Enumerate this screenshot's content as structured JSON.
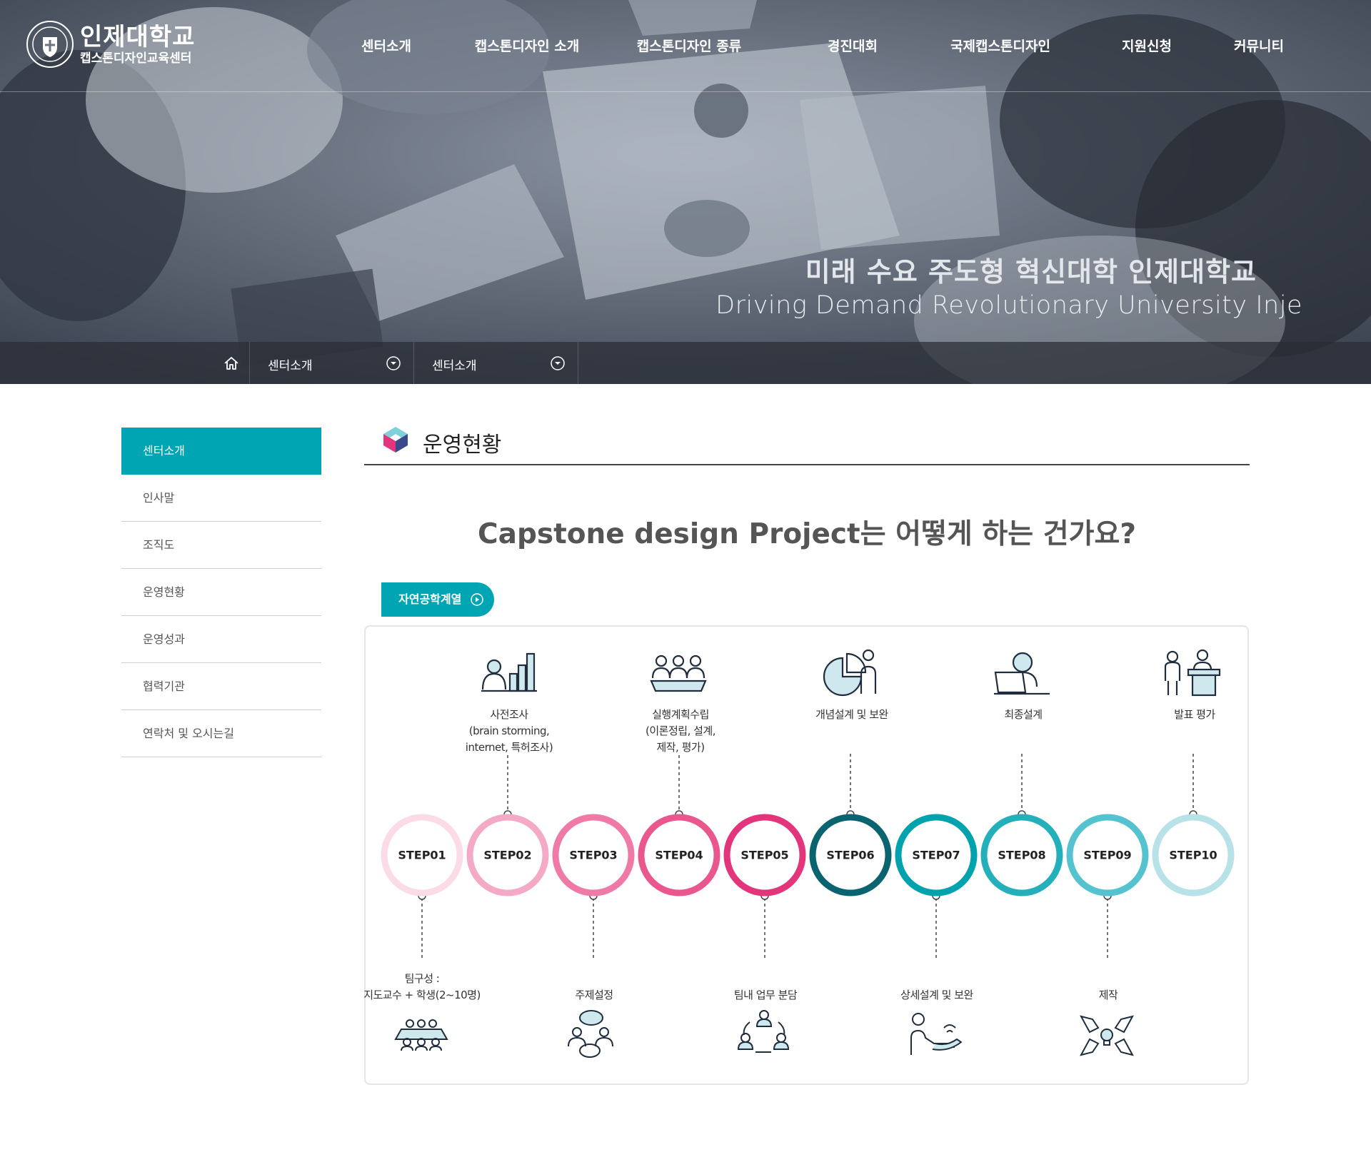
{
  "header": {
    "logo_name": "인제대학교",
    "logo_sub": "캡스톤디자인교육센터",
    "nav": [
      "센터소개",
      "캡스톤디자인 소개",
      "캡스톤디자인 종류",
      "경진대회",
      "국제캡스톤디자인",
      "지원신청",
      "커뮤니티"
    ]
  },
  "hero": {
    "title": "미래 수요 주도형 혁신대학 인제대학교",
    "subtitle": "Driving Demand Revolutionary University Inje"
  },
  "breadcrumb": {
    "home_icon": "home-icon",
    "level1": "센터소개",
    "level2": "센터소개"
  },
  "lnb": {
    "items": [
      "센터소개",
      "인사말",
      "조직도",
      "운영현황",
      "운영성과",
      "협력기관",
      "연락처 및 오시는길"
    ],
    "active_index": 0
  },
  "content": {
    "page_title": "운영현황",
    "question": "Capstone design Project는 어떻게 하는 건가요?",
    "tag_label": "자연공학계열"
  },
  "process": {
    "steps": [
      "STEP01",
      "STEP02",
      "STEP03",
      "STEP04",
      "STEP05",
      "STEP06",
      "STEP07",
      "STEP08",
      "STEP09",
      "STEP10"
    ],
    "step_colors": [
      "#fbdbe7",
      "#f4a9c6",
      "#ef7aa7",
      "#e9578e",
      "#e3357b",
      "#0a6470",
      "#00a2ad",
      "#23b0ba",
      "#54c3cf",
      "#b7e2e7"
    ],
    "top_descriptions": [
      {
        "step": 2,
        "lines": [
          "사전조사",
          "(brain storming,",
          "internet, 특허조사)"
        ],
        "icon": "research-chart-icon"
      },
      {
        "step": 4,
        "lines": [
          "실행계획수립",
          "(이론정립, 설계,",
          "제작, 평가)"
        ],
        "icon": "team-meeting-icon"
      },
      {
        "step": 6,
        "lines": [
          "개념설계 및 보완"
        ],
        "icon": "pie-chart-presenter-icon"
      },
      {
        "step": 8,
        "lines": [
          "최종설계"
        ],
        "icon": "laptop-user-icon"
      },
      {
        "step": 10,
        "lines": [
          "발표 평가"
        ],
        "icon": "presentation-podium-icon"
      }
    ],
    "bottom_descriptions": [
      {
        "step": 1,
        "lines": [
          "팀구성 :",
          "지도교수 + 학생(2~10명)"
        ],
        "icon": "team-table-icon"
      },
      {
        "step": 3,
        "lines": [
          "주제설정"
        ],
        "icon": "discussion-icon"
      },
      {
        "step": 5,
        "lines": [
          "팀내 업무 분담"
        ],
        "icon": "workflow-cycle-icon"
      },
      {
        "step": 7,
        "lines": [
          "상세설계 및 보완"
        ],
        "icon": "hand-wifi-icon"
      },
      {
        "step": 9,
        "lines": [
          "제작"
        ],
        "icon": "collaboration-hands-icon"
      }
    ]
  }
}
